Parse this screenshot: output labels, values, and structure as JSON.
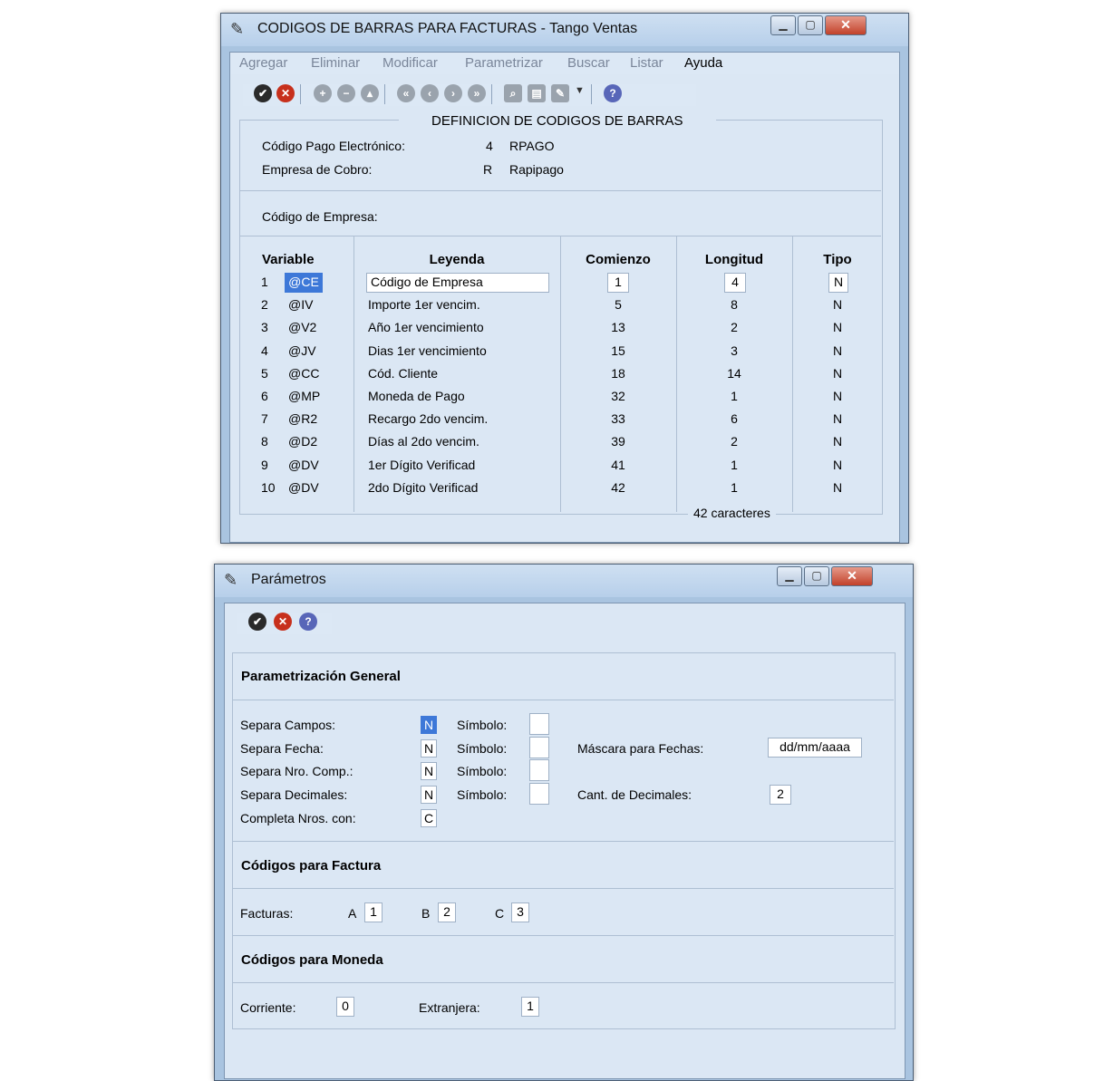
{
  "window1": {
    "title": "CODIGOS DE BARRAS PARA FACTURAS - Tango Ventas",
    "menu": [
      "Agregar",
      "Eliminar",
      "Modificar",
      "Parametrizar",
      "Buscar",
      "Listar",
      "Ayuda"
    ],
    "section_title": "DEFINICION DE CODIGOS DE BARRAS",
    "codigo_pago_label": "Código Pago Electrónico:",
    "codigo_pago_value": "4",
    "codigo_pago_name": "RPAGO",
    "empresa_cobro_label": "Empresa de Cobro:",
    "empresa_cobro_value": "R",
    "empresa_cobro_name": "Rapipago",
    "codigo_empresa_label": "Código de Empresa:",
    "columns": [
      "Variable",
      "Leyenda",
      "Comienzo",
      "Longitud",
      "Tipo"
    ],
    "rows": [
      {
        "n": "1",
        "var": "@CE",
        "leyenda": "Código de Empresa",
        "comienzo": "1",
        "longitud": "4",
        "tipo": "N"
      },
      {
        "n": "2",
        "var": "@IV",
        "leyenda": "Importe 1er vencim.",
        "comienzo": "5",
        "longitud": "8",
        "tipo": "N"
      },
      {
        "n": "3",
        "var": "@V2",
        "leyenda": "Año 1er vencimiento",
        "comienzo": "13",
        "longitud": "2",
        "tipo": "N"
      },
      {
        "n": "4",
        "var": "@JV",
        "leyenda": "Dias 1er vencimiento",
        "comienzo": "15",
        "longitud": "3",
        "tipo": "N"
      },
      {
        "n": "5",
        "var": "@CC",
        "leyenda": "Cód. Cliente",
        "comienzo": "18",
        "longitud": "14",
        "tipo": "N"
      },
      {
        "n": "6",
        "var": "@MP",
        "leyenda": "Moneda de Pago",
        "comienzo": "32",
        "longitud": "1",
        "tipo": "N"
      },
      {
        "n": "7",
        "var": "@R2",
        "leyenda": "Recargo 2do vencim.",
        "comienzo": "33",
        "longitud": "6",
        "tipo": "N"
      },
      {
        "n": "8",
        "var": "@D2",
        "leyenda": "Días al 2do vencim.",
        "comienzo": "39",
        "longitud": "2",
        "tipo": "N"
      },
      {
        "n": "9",
        "var": "@DV",
        "leyenda": "1er Dígito Verificad",
        "comienzo": "41",
        "longitud": "1",
        "tipo": "N"
      },
      {
        "n": "10",
        "var": "@DV",
        "leyenda": "2do Dígito Verificad",
        "comienzo": "42",
        "longitud": "1",
        "tipo": "N"
      }
    ],
    "total": "42 caracteres"
  },
  "window2": {
    "title": "Parámetros",
    "general_title": "Parametrización General",
    "separa_campos": {
      "label": "Separa Campos:",
      "value": "N",
      "simbolo_label": "Símbolo:",
      "simbolo": ""
    },
    "separa_fecha": {
      "label": "Separa Fecha:",
      "value": "N",
      "simbolo_label": "Símbolo:",
      "simbolo": ""
    },
    "separa_nro": {
      "label": "Separa Nro. Comp.:",
      "value": "N",
      "simbolo_label": "Símbolo:",
      "simbolo": ""
    },
    "separa_decimales": {
      "label": "Separa Decimales:",
      "value": "N",
      "simbolo_label": "Símbolo:",
      "simbolo": ""
    },
    "completa": {
      "label": "Completa Nros. con:",
      "value": "C"
    },
    "mascara": {
      "label": "Máscara para Fechas:",
      "value": "dd/mm/aaaa"
    },
    "decimales": {
      "label": "Cant. de Decimales:",
      "value": "2"
    },
    "factura_title": "Códigos para Factura",
    "facturas_label": "Facturas:",
    "fact_a_label": "A",
    "fact_a": "1",
    "fact_b_label": "B",
    "fact_b": "2",
    "fact_c_label": "C",
    "fact_c": "3",
    "moneda_title": "Códigos para Moneda",
    "corriente_label": "Corriente:",
    "corriente": "0",
    "extranjera_label": "Extranjera:",
    "extranjera": "1"
  },
  "colors": {
    "window_frame": "#a9c4e0",
    "client_bg": "#dbe7f4",
    "close_button": "#c7301c",
    "selection": "#3d78d8"
  }
}
